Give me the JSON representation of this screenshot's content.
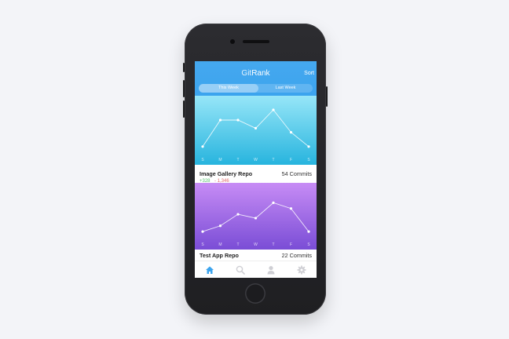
{
  "app": {
    "title_part1": "Git",
    "title_part2": "Rank",
    "sort_label": "Sort"
  },
  "segmented": {
    "tabs": [
      "This Week",
      "Last Week"
    ],
    "active": "This Week"
  },
  "days": [
    "S",
    "M",
    "T",
    "W",
    "T",
    "F",
    "S"
  ],
  "repos": [
    {
      "name": "Image Gallery Repo",
      "commits": "54 Commits",
      "additions": "+328",
      "deletions": "- 1,346",
      "chart_values": [
        0.1,
        0.75,
        0.75,
        0.55,
        1.0,
        0.45,
        0.1
      ],
      "gradient": [
        "#97e6f8",
        "#27b4de"
      ]
    },
    {
      "name": "Test App Repo",
      "commits": "22 Commits",
      "chart_values": [
        0.1,
        0.25,
        0.55,
        0.45,
        0.85,
        0.7,
        0.1
      ],
      "gradient": [
        "#c78cf5",
        "#7a4dd6"
      ]
    }
  ],
  "tabbar": {
    "items": [
      "home-icon",
      "search-icon",
      "user-icon",
      "gear-icon"
    ],
    "active_color": "#3ca4ee",
    "inactive_color": "#cfcfd4"
  }
}
